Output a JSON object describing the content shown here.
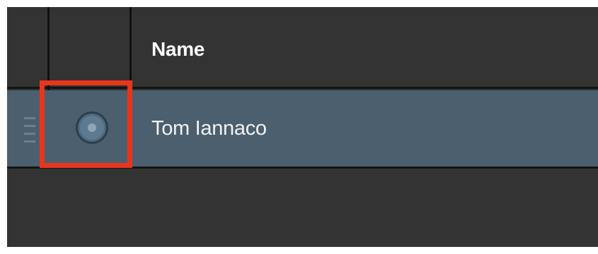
{
  "table": {
    "columns": {
      "name_header": "Name"
    },
    "rows": [
      {
        "name": "Tom Iannaco",
        "selected": false
      }
    ]
  },
  "colors": {
    "background": "#333333",
    "row_highlight": "#4b5f6e",
    "annotation": "#e8361c"
  },
  "icons": {
    "drag_handle": "drag-handle-icon",
    "radio": "radio-button"
  }
}
